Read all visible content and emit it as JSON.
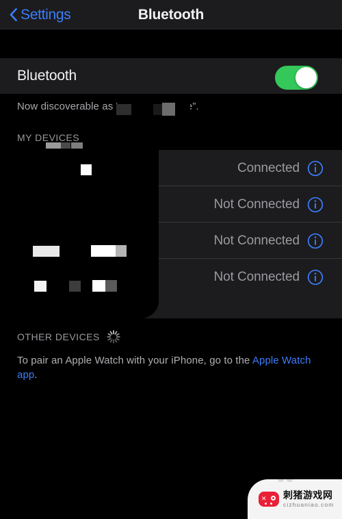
{
  "nav": {
    "back_label": "Settings",
    "title": "Bluetooth",
    "accent": "#3c7dfc"
  },
  "bluetooth": {
    "label": "Bluetooth",
    "toggle_state": "on",
    "toggle_color": "#34c759",
    "discoverable_text": "Now discoverable as “███ ██ █hone”."
  },
  "my_devices": {
    "header": "MY DEVICES",
    "rows": [
      {
        "name": "████████",
        "status": "Connected",
        "info_icon": "info-circle-icon"
      },
      {
        "name": "██████",
        "status": "Not Connected",
        "info_icon": "info-circle-icon"
      },
      {
        "name": "████ █████",
        "status": "Not Connected",
        "info_icon": "info-circle-icon"
      },
      {
        "name": "██ █ ███",
        "status": "Not Connected",
        "info_icon": "info-circle-icon"
      }
    ]
  },
  "other_devices": {
    "header": "OTHER DEVICES",
    "spinner_icon": "activity-spinner-icon",
    "footer_prefix": "To pair an Apple Watch with your iPhone, go to the ",
    "footer_link": "Apple Watch app",
    "footer_suffix": "."
  },
  "watermark": {
    "icon": "gamepad-icon",
    "brand_cn": "刺猪游戏网",
    "brand_url": "cizhuaniao.com",
    "brand_color": "#ea2136"
  }
}
